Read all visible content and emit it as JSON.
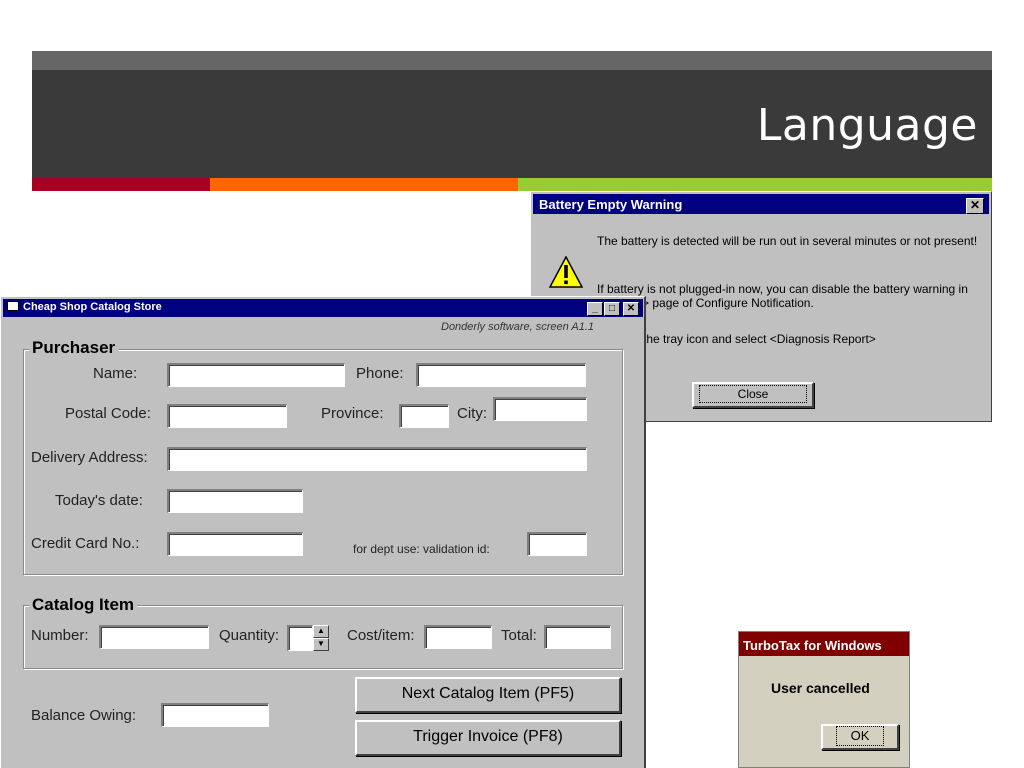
{
  "slide": {
    "title": "Language"
  },
  "battery_dialog": {
    "title": "Battery Empty Warning",
    "close_icon": "close-icon",
    "messages": [
      "The battery is detected will be run out in several minutes or not present!",
      "If battery is not plugged-in now, you can disable the battery warning in <Battery> page of Configure Notification.",
      "Or, click the tray icon and select <Diagnosis Report>"
    ],
    "close_label": "Close"
  },
  "turbotax_dialog": {
    "title": "TurboTax for Windows",
    "message": "User cancelled",
    "ok_label": "OK"
  },
  "shop_form": {
    "title": "Cheap Shop Catalog Store",
    "credit": "Donderly software, screen A1.1",
    "purchaser": {
      "group_title": "Purchaser",
      "name_label": "Name:",
      "phone_label": "Phone:",
      "postal_label": "Postal Code:",
      "province_label": "Province:",
      "city_label": "City:",
      "address_label": "Delivery Address:",
      "date_label": "Today's date:",
      "card_label": "Credit Card No.:",
      "validation_label": "for dept use: validation id:"
    },
    "catalog": {
      "group_title": "Catalog Item",
      "number_label": "Number:",
      "quantity_label": "Quantity:",
      "cost_label": "Cost/item:",
      "total_label": "Total:"
    },
    "balance_label": "Balance Owing:",
    "next_button": "Next Catalog Item (PF5)",
    "invoice_button": "Trigger Invoice (PF8)",
    "window_controls": [
      "minimize-icon",
      "maximize-icon",
      "close-icon"
    ]
  }
}
